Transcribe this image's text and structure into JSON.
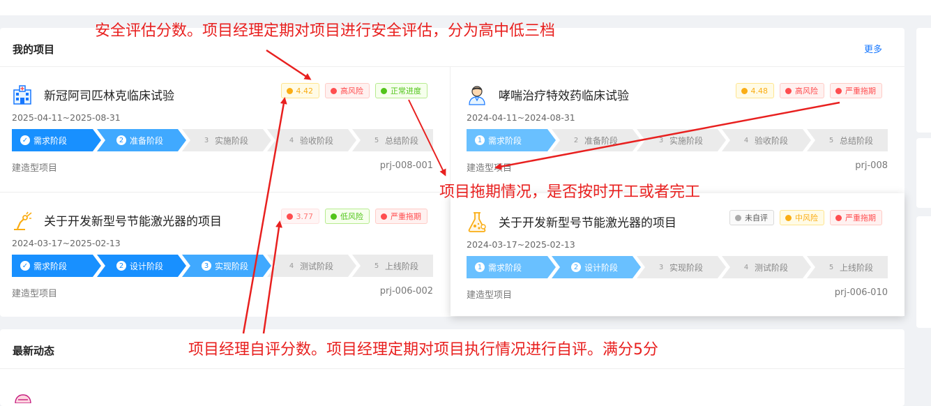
{
  "projects": {
    "title": "我的项目",
    "more": "更多",
    "cards": [
      {
        "title": "新冠阿司匹林克临床试验",
        "date": "2025-04-11~2025-08-31",
        "type": "建造型项目",
        "code": "prj-008-001",
        "badges": [
          "4.42",
          "高风险",
          "正常进度"
        ],
        "steps": [
          "需求阶段",
          "准备阶段",
          "实施阶段",
          "验收阶段",
          "总结阶段"
        ],
        "step_nums": [
          "✓",
          "2",
          "3",
          "4",
          "5"
        ]
      },
      {
        "title": "哮喘治疗特效药临床试验",
        "date": "2024-04-11~2024-08-31",
        "type": "建造型项目",
        "code": "prj-008",
        "badges": [
          "4.48",
          "高风险",
          "严重拖期"
        ],
        "steps": [
          "需求阶段",
          "准备阶段",
          "实施阶段",
          "验收阶段",
          "总结阶段"
        ],
        "step_nums": [
          "1",
          "2",
          "3",
          "4",
          "5"
        ]
      },
      {
        "title": "关于开发新型号节能激光器的项目",
        "date": "2024-03-17~2025-02-13",
        "type": "建造型项目",
        "code": "prj-006-002",
        "badges": [
          "3.77",
          "低风险",
          "严重拖期"
        ],
        "steps": [
          "需求阶段",
          "设计阶段",
          "实现阶段",
          "测试阶段",
          "上线阶段"
        ],
        "step_nums": [
          "✓",
          "2",
          "3",
          "4",
          "5"
        ]
      },
      {
        "title": "关于开发新型号节能激光器的项目",
        "date": "2024-03-17~2025-02-13",
        "type": "建造型项目",
        "code": "prj-006-010",
        "badges": [
          "未自评",
          "中风险",
          "严重拖期"
        ],
        "steps": [
          "需求阶段",
          "设计阶段",
          "实现阶段",
          "测试阶段",
          "上线阶段"
        ],
        "step_nums": [
          "1",
          "2",
          "3",
          "4",
          "5"
        ]
      }
    ]
  },
  "news": {
    "title": "最新动态"
  },
  "annotations": {
    "safety": "安全评估分数。项目经理定期对项目进行安全评估，分为高中低三档",
    "delay": "项目拖期情况，是否按时开工或者完工",
    "self_eval": "项目经理自评分数。项目经理定期对项目执行情况进行自评。满分5分"
  },
  "colors": {
    "accent": "#1890ff",
    "annotation": "#e8201f"
  }
}
